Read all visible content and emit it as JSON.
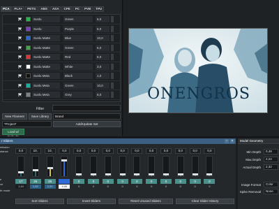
{
  "tabs": [
    "PCA",
    "PLA+",
    "PETG",
    "ABS",
    "ASA",
    "CPE",
    "PC",
    "PVB",
    "TPU"
  ],
  "filaments": [
    {
      "name": "Sunlu",
      "color": "Green",
      "value": "6,0",
      "swatch": "#2bb24c"
    },
    {
      "name": "Sunlu",
      "color": "Purple",
      "value": "6,0",
      "swatch": "#7b3fb6"
    },
    {
      "name": "Sunlu Matte",
      "color": "Blue",
      "value": "10,0",
      "swatch": "#2a67c9"
    },
    {
      "name": "Sunlu Matte",
      "color": "Green",
      "value": "6,0",
      "swatch": "#47a14a"
    },
    {
      "name": "Sunlu Matte",
      "color": "Red",
      "value": "6,0",
      "swatch": "#d33a3a"
    },
    {
      "name": "Sunlu Matte",
      "color": "White",
      "value": "3,0",
      "swatch": "#ffffff"
    },
    {
      "name": "Sunlu Meta",
      "color": "Black",
      "value": "1,0",
      "swatch": "#111111"
    },
    {
      "name": "Sunlu Meta",
      "color": "Green",
      "value": "10,0",
      "swatch": "#1fae9e"
    },
    {
      "name": "Sunlu Meta",
      "color": "Grey",
      "value": "6,0",
      "swatch": "#7f8286"
    }
  ],
  "filter_label": "Filter",
  "buttons": {
    "new_filament": "New Filament",
    "save_library": "Save Library",
    "add_update_set": "Add/Update Set",
    "load_defaults": "Load w/ Defaults",
    "sort_sliders": "Sort Sliders",
    "invert_sliders": "Invert Sliders",
    "reset_unused": "Reset Unused Sliders",
    "clear_history": "Clear Slider History"
  },
  "brand_value": "Brand",
  "project_value": "*Project*",
  "photo_caption": "ONENGROS",
  "sliders_title": "r Sliders",
  "side_labels": [
    "mission",
    "stance",
    "e",
    "ve",
    "th mode"
  ],
  "slider_cols": [
    {
      "top": "0,0",
      "num": "17",
      "bottom": "1,44",
      "level": 0.2,
      "fill": "#2a6a6a",
      "num_bg": "#4a8f8a",
      "bot_bg": "#1b1d1f"
    },
    {
      "top": "10,",
      "num": "26",
      "bottom": "1,92",
      "level": 0.3,
      "fill": "#2a6a6a",
      "num_bg": "#4a8f8a",
      "bot_bg": "#2a5f86"
    },
    {
      "top": "10,",
      "num": "26",
      "bottom": "2,32",
      "level": 0.4,
      "fill": "#d9c24a",
      "num_bg": "#4a8f8a",
      "bot_bg": "#2a5f86"
    },
    {
      "top": "0,0",
      "num": "",
      "bottom": "4,00",
      "level": 0.75,
      "fill": "#2e6bd6",
      "num_bg": "#2e6bd6",
      "bot_bg": "#ffffff"
    },
    {
      "top": "0,0",
      "num": "0",
      "bottom": "0",
      "level": 0.1,
      "fill": "#2a6a6a",
      "num_bg": "#4a8f8a",
      "bot_bg": "#24282b"
    },
    {
      "top": "0,0",
      "num": "0",
      "bottom": "0",
      "level": 0.1,
      "fill": "#2a6a6a",
      "num_bg": "#4a8f8a",
      "bot_bg": "#24282b"
    },
    {
      "top": "0,0",
      "num": "0",
      "bottom": "0",
      "level": 0.1,
      "fill": "#2a6a6a",
      "num_bg": "#4a8f8a",
      "bot_bg": "#24282b"
    },
    {
      "top": "0,0",
      "num": "0",
      "bottom": "0",
      "level": 0.1,
      "fill": "#2a6a6a",
      "num_bg": "#4a8f8a",
      "bot_bg": "#24282b"
    },
    {
      "top": "0,0",
      "num": "0",
      "bottom": "0",
      "level": 0.1,
      "fill": "#2a6a6a",
      "num_bg": "#4a8f8a",
      "bot_bg": "#24282b"
    },
    {
      "top": "0,0",
      "num": "0",
      "bottom": "0",
      "level": 0.1,
      "fill": "#2a6a6a",
      "num_bg": "#4a8f8a",
      "bot_bg": "#24282b"
    },
    {
      "top": "0,0",
      "num": "0",
      "bottom": "0",
      "level": 0.1,
      "fill": "#2a6a6a",
      "num_bg": "#4a8f8a",
      "bot_bg": "#24282b"
    },
    {
      "top": "0,0",
      "num": "0",
      "bottom": "0",
      "level": 0.1,
      "fill": "#2a6a6a",
      "num_bg": "#4a8f8a",
      "bot_bg": "#24282b"
    },
    {
      "top": "0,0",
      "num": "0",
      "bottom": "0",
      "level": 0.1,
      "fill": "#2a6a6a",
      "num_bg": "#4a8f8a",
      "bot_bg": "#24282b"
    },
    {
      "top": "0,0",
      "num": "0",
      "bottom": "0",
      "level": 0.1,
      "fill": "#2a6a6a",
      "num_bg": "#4a8f8a",
      "bot_bg": "#24282b"
    }
  ],
  "geometry": {
    "title": "Model Geometry",
    "rows": [
      {
        "label": "Min Depth",
        "value": "0,48"
      },
      {
        "label": "Max Depth",
        "value": "2,24"
      },
      {
        "label": "Actual Depth",
        "value": "2,32"
      },
      {
        "label": "Image Format",
        "value": "Color"
      },
      {
        "label": "Spike Removal",
        "value": "None"
      }
    ]
  }
}
